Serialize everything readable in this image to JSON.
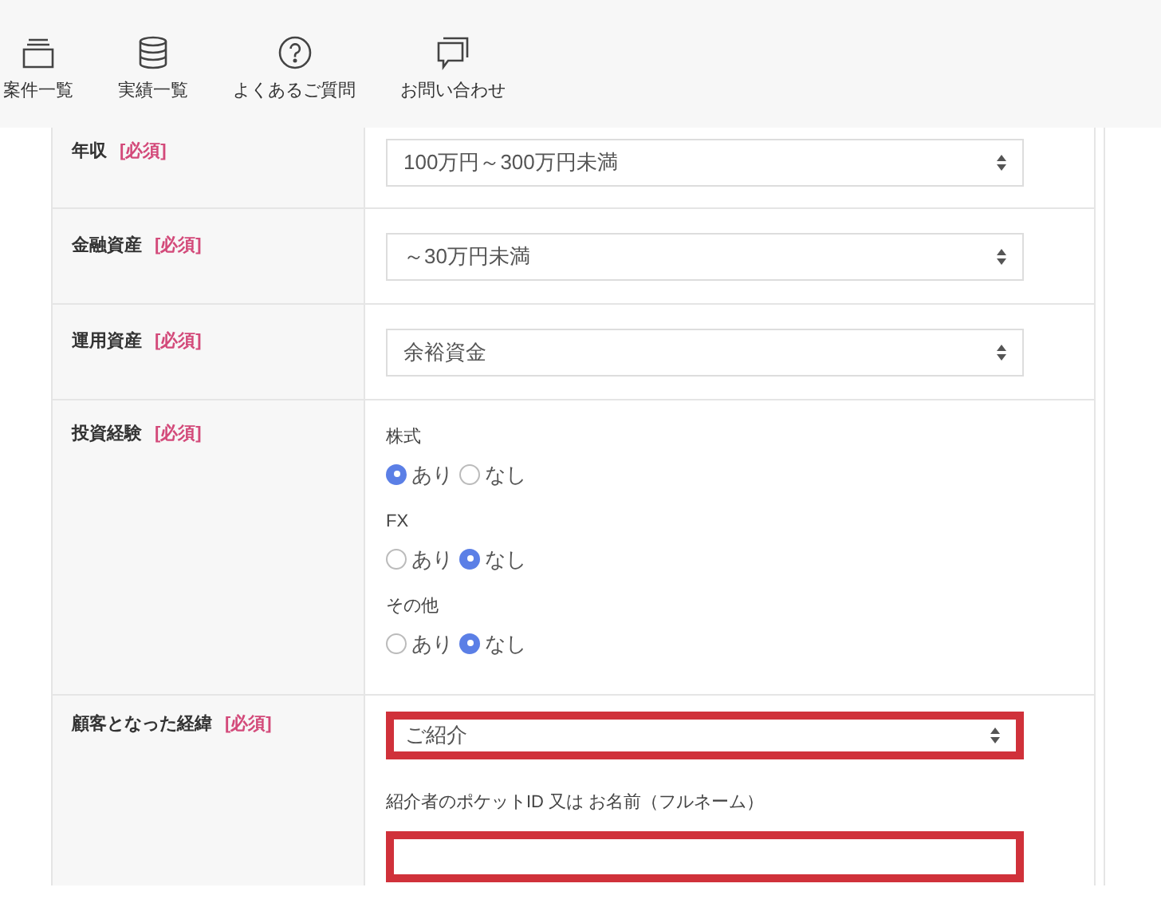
{
  "nav": [
    {
      "label": "案件一覧"
    },
    {
      "label": "実績一覧"
    },
    {
      "label": "よくあるご質問"
    },
    {
      "label": "お問い合わせ"
    }
  ],
  "rows": [
    {
      "label": "年収",
      "required": "[必須]",
      "kind": "select",
      "value": "100万円～300万円未満",
      "highlighted": false
    },
    {
      "label": "金融資産",
      "required": "[必須]",
      "kind": "select",
      "value": "～30万円未満",
      "highlighted": false
    },
    {
      "label": "運用資産",
      "required": "[必須]",
      "kind": "select",
      "value": "余裕資金",
      "highlighted": false
    },
    {
      "label": "投資経験",
      "required": "[必須]",
      "kind": "radio",
      "groups": [
        {
          "label": "株式",
          "options": [
            {
              "label": "あり",
              "selected": true
            },
            {
              "label": "なし",
              "selected": false
            }
          ]
        },
        {
          "label": "FX",
          "options": [
            {
              "label": "あり",
              "selected": false
            },
            {
              "label": "なし",
              "selected": true
            }
          ]
        },
        {
          "label": "その他",
          "options": [
            {
              "label": "あり",
              "selected": false
            },
            {
              "label": "なし",
              "selected": true
            }
          ]
        }
      ]
    },
    {
      "label": "顧客となった経緯",
      "required": "[必須]",
      "kind": "select-with-input",
      "value": "ご紹介",
      "highlighted": true,
      "input_label": "紹介者のポケットID 又は お名前（フルネーム）",
      "input_highlighted": true
    }
  ]
}
